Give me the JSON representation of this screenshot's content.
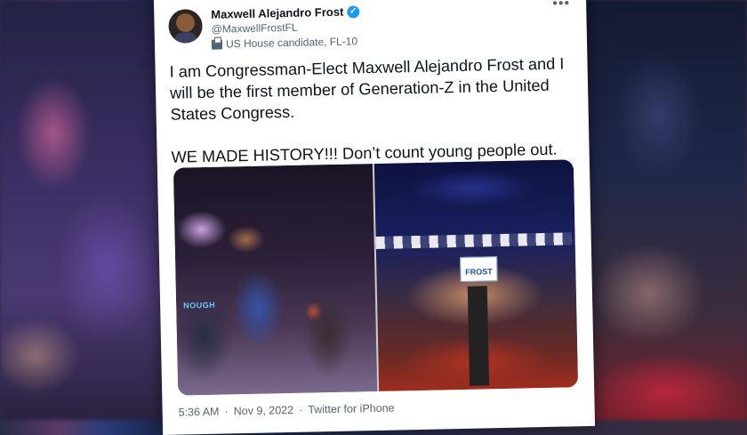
{
  "tweet": {
    "author_name": "Maxwell Alejandro Frost",
    "handle": "@MaxwellFrostFL",
    "label": "US House candidate, FL-10",
    "text": "I am Congressman-Elect Maxwell Alejandro Frost and I will be the first member of Generation-Z in the United States Congress.\n\nWE MADE HISTORY!!! Don’t count young people out.",
    "more_label": "•••",
    "verified_mark": "✓",
    "photo_right_sign": "FROST",
    "photo_left_shirt_text": "NOUGH",
    "time": "5:36 AM",
    "separator": "·",
    "date": "Nov 9, 2022",
    "source": "Twitter for iPhone"
  },
  "icons": {
    "verified": "verified-badge-icon",
    "label": "ballot-box-icon",
    "more": "more-options-icon"
  },
  "colors": {
    "accent": "#1d9bf0",
    "text": "#0f1419",
    "muted": "#536471"
  }
}
